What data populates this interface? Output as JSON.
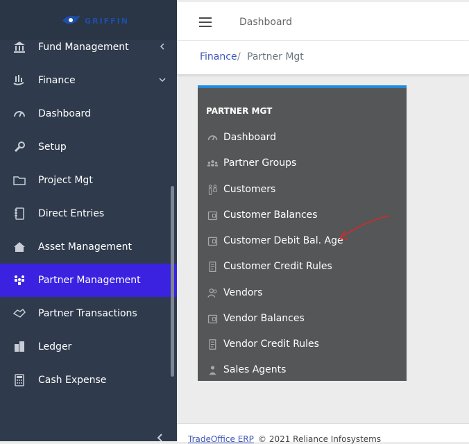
{
  "app": {
    "logo_text": "GRIFFIN"
  },
  "sidebar": {
    "items": [
      {
        "label": "Fund Management",
        "icon": "bank-icon"
      },
      {
        "label": "Finance",
        "icon": "chart-hand-icon"
      },
      {
        "label": "Dashboard",
        "icon": "gauge-icon"
      },
      {
        "label": "Setup",
        "icon": "wrench-icon"
      },
      {
        "label": "Project Mgt",
        "icon": "folder-icon"
      },
      {
        "label": "Direct Entries",
        "icon": "ledger-book-icon"
      },
      {
        "label": "Asset Management",
        "icon": "house-icon"
      },
      {
        "label": "Partner Management",
        "icon": "people-icon",
        "active": true
      },
      {
        "label": "Partner Transactions",
        "icon": "handshake-icon"
      },
      {
        "label": "Ledger",
        "icon": "building-icon"
      },
      {
        "label": "Cash Expense",
        "icon": "calculator-icon"
      }
    ]
  },
  "topbar": {
    "title": "Dashboard"
  },
  "breadcrumb": {
    "parent": "Finance",
    "separator": "/",
    "current": "Partner Mgt"
  },
  "panel": {
    "title": "PARTNER MGT",
    "items": [
      {
        "label": "Dashboard",
        "icon": "gauge-icon"
      },
      {
        "label": "Partner Groups",
        "icon": "group-icon"
      },
      {
        "label": "Customers",
        "icon": "couple-icon"
      },
      {
        "label": "Customer Balances",
        "icon": "wallet-icon"
      },
      {
        "label": "Customer Debit Bal. Age",
        "icon": "wallet-icon"
      },
      {
        "label": "Customer Credit Rules",
        "icon": "receipt-icon"
      },
      {
        "label": "Vendors",
        "icon": "users-icon"
      },
      {
        "label": "Vendor Balances",
        "icon": "wallet-icon"
      },
      {
        "label": "Vendor Credit Rules",
        "icon": "receipt-icon"
      },
      {
        "label": "Sales Agents",
        "icon": "agent-icon"
      }
    ]
  },
  "footer": {
    "link": "TradeOffice ERP",
    "text": "© 2021 Reliance Infosystems"
  },
  "colors": {
    "sidebar_bg": "#2f3b4c",
    "active": "#3a22e0",
    "panel_bg": "#555657",
    "panel_accent": "#1f8bdb",
    "annotation": "#d42a2a"
  }
}
